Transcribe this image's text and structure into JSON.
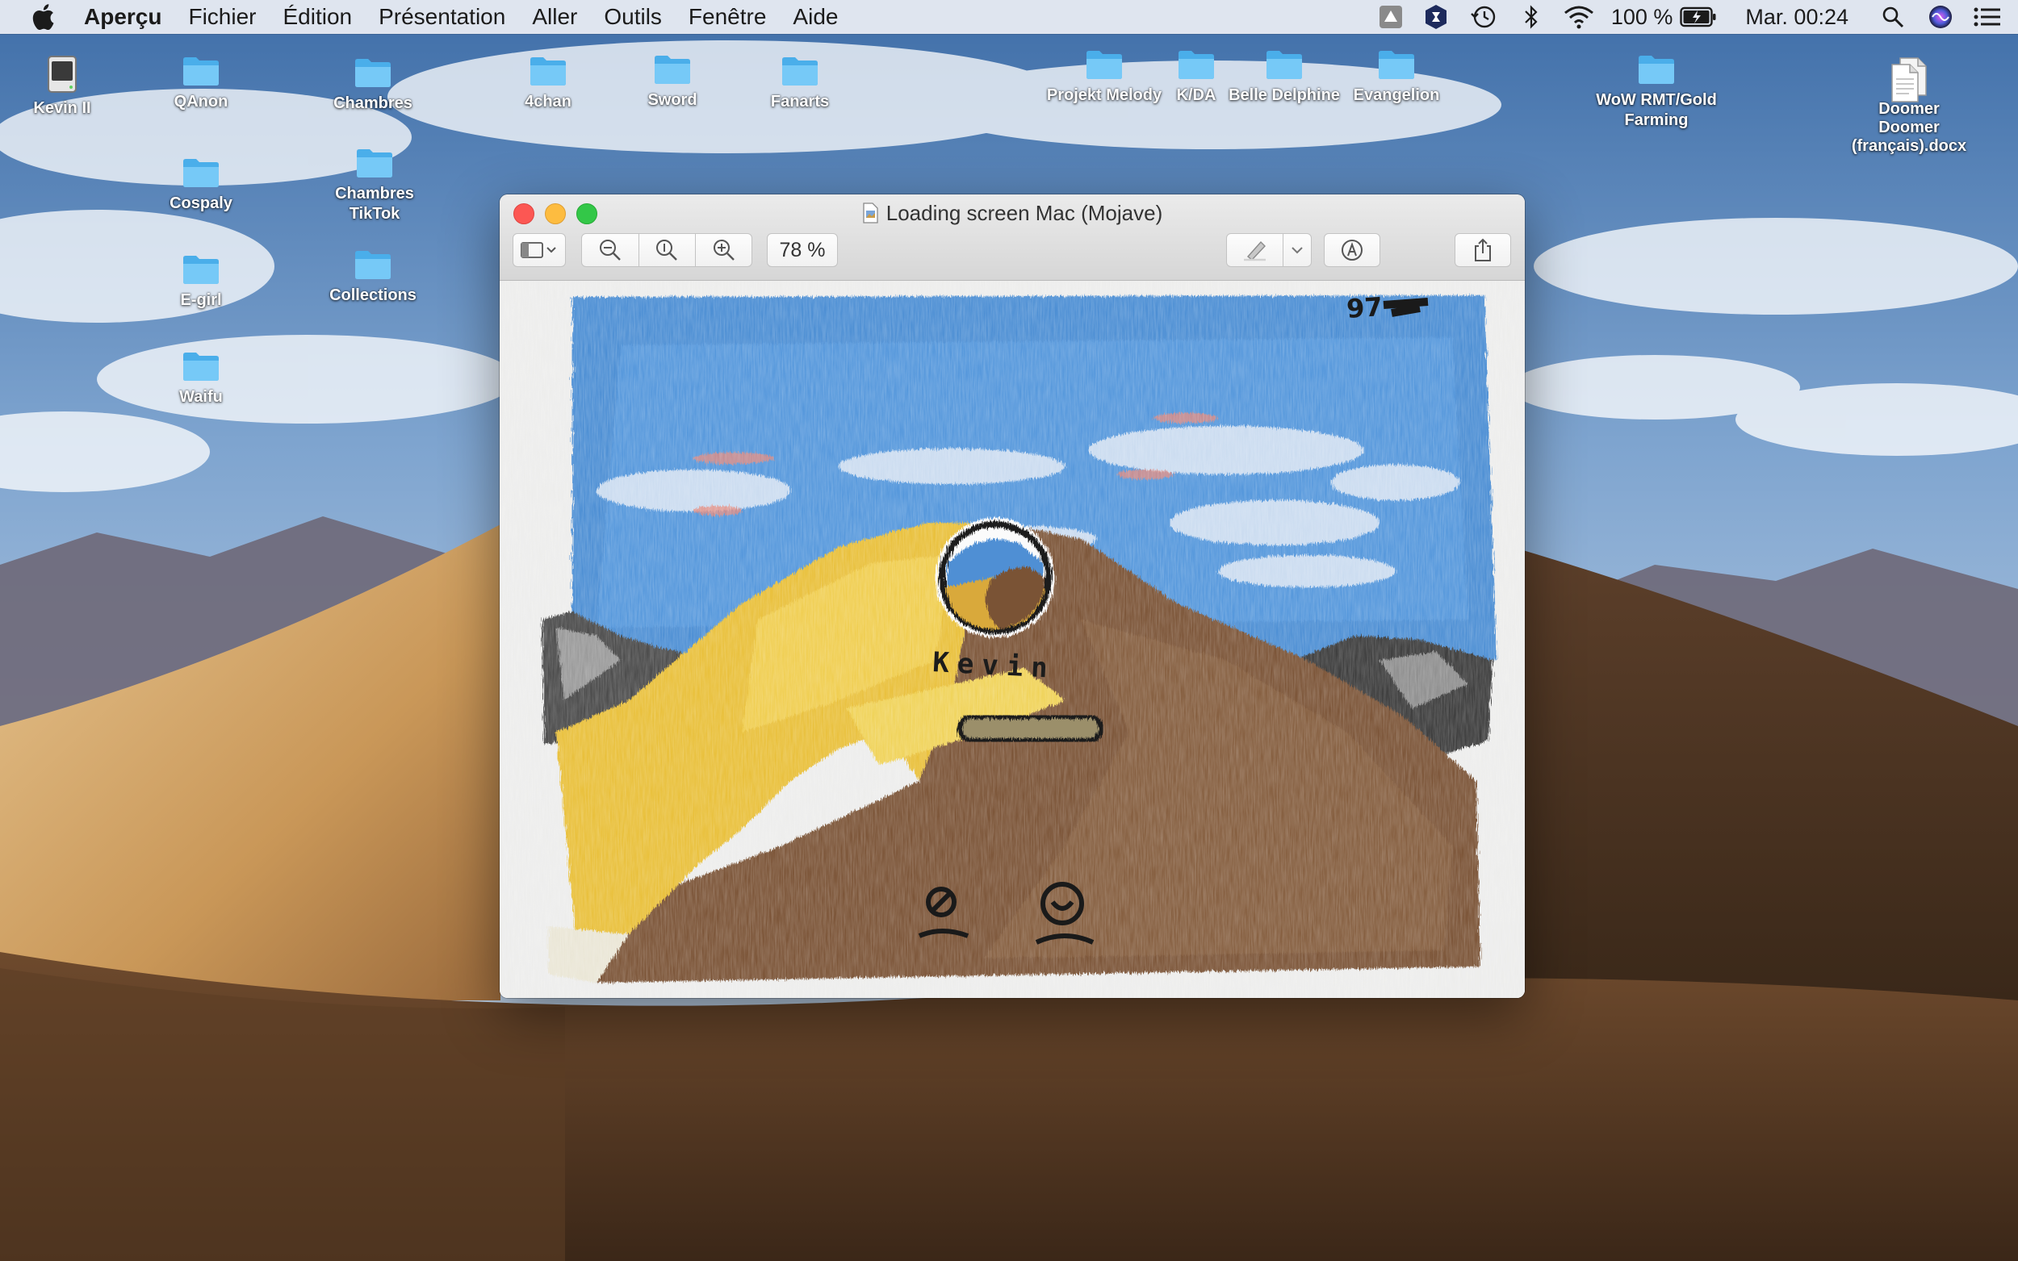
{
  "menubar": {
    "app_name": "Aperçu",
    "menus": [
      "Fichier",
      "Édition",
      "Présentation",
      "Aller",
      "Outils",
      "Fenêtre",
      "Aide"
    ],
    "battery": "100 %",
    "clock": "Mar. 00:24"
  },
  "desktop": {
    "icons": [
      {
        "label": "Kevin II",
        "type": "drive"
      },
      {
        "label": "QAnon",
        "type": "folder"
      },
      {
        "label": "Chambres",
        "type": "folder"
      },
      {
        "label": "4chan",
        "type": "folder"
      },
      {
        "label": "Sword",
        "type": "folder"
      },
      {
        "label": "Fanarts",
        "type": "folder"
      },
      {
        "label": "Projekt Melody",
        "type": "folder"
      },
      {
        "label": "K/DA",
        "type": "folder"
      },
      {
        "label": "Belle Delphine",
        "type": "folder"
      },
      {
        "label": "Evangelion",
        "type": "folder"
      },
      {
        "label": "WoW RMT/Gold\nFarming",
        "type": "folder"
      },
      {
        "label": "Doomer\nDoomer\n(français).docx",
        "type": "document"
      },
      {
        "label": "Cospaly",
        "type": "folder"
      },
      {
        "label": "Chambres\nTikTok",
        "type": "folder"
      },
      {
        "label": "E-girl",
        "type": "folder"
      },
      {
        "label": "Collections",
        "type": "folder"
      },
      {
        "label": "Waifu",
        "type": "folder"
      }
    ]
  },
  "window": {
    "title": "Loading screen Mac (Mojave)",
    "zoom": "78 %"
  },
  "drawing": {
    "name_text": "Kevin",
    "corner_scribble": "97"
  },
  "colors": {
    "sky": "#4b8fd6",
    "dune_yellow": "#e8bf3a",
    "dune_brown": "#7a5236",
    "menubar_bg": "#eceef4",
    "folder_blue": "#5bb8f2"
  }
}
